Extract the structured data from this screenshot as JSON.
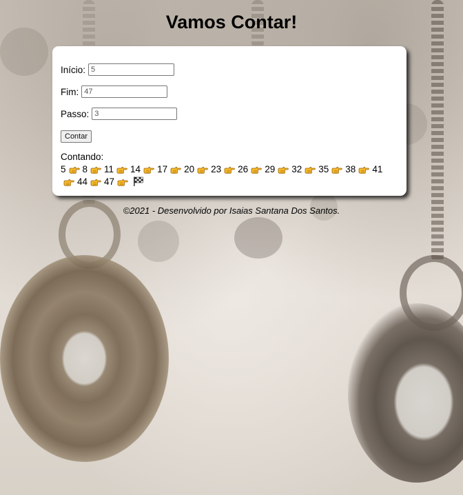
{
  "page": {
    "title": "Vamos Contar!"
  },
  "form": {
    "inicio_label": "Início:",
    "inicio_value": "5",
    "fim_label": "Fim:",
    "fim_value": "47",
    "passo_label": "Passo:",
    "passo_value": "3",
    "button_label": "Contar"
  },
  "result": {
    "heading": "Contando:",
    "sequence": [
      "5",
      "8",
      "11",
      "14",
      "17",
      "20",
      "23",
      "26",
      "29",
      "32",
      "35",
      "38",
      "41",
      "44",
      "47"
    ],
    "separator_icon": "pointing-hand-icon",
    "end_icon": "checkered-flag-icon"
  },
  "footer": {
    "text": "©2021 - Desenvolvido por Isaias Santana Dos Santos."
  },
  "colors": {
    "card_bg": "#ffffff",
    "hand": "#f5b829",
    "text": "#000000"
  }
}
